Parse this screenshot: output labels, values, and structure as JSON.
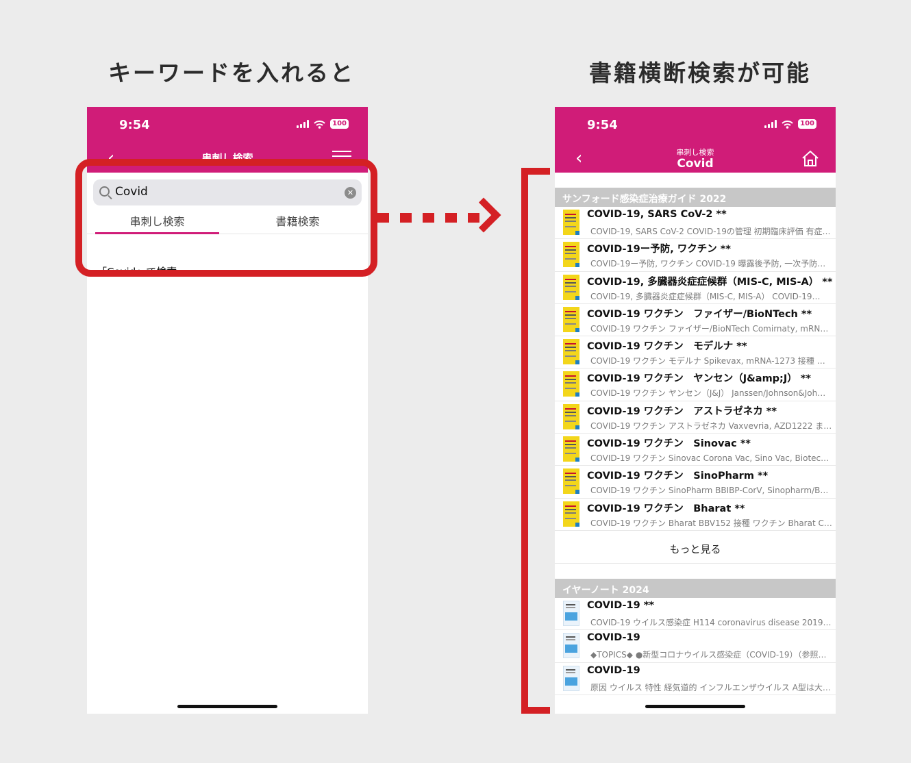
{
  "headings": {
    "left": "キーワードを入れると",
    "right": "書籍横断検索が可能"
  },
  "left_phone": {
    "time": "9:54",
    "battery": "100",
    "nav_title": "串刺し検索",
    "search_value": "Covid",
    "tabs": [
      "串刺し検索",
      "書籍検索"
    ],
    "suggestion": "「Covid」で検索"
  },
  "right_phone": {
    "time": "9:54",
    "battery": "100",
    "nav_sub": "串刺し検索",
    "nav_title": "Covid",
    "sections": [
      {
        "title": "サンフォード感染症治療ガイド 2022",
        "thumb": "yellow",
        "items": [
          {
            "title": "COVID-19, SARS CoV-2 **",
            "sub": "COVID-19, SARS CoV-2 COVID-19の管理 初期臨床評価 有症…"
          },
          {
            "title": "COVID-19ー予防, ワクチン **",
            "sub": "COVID-19ー予防, ワクチン COVID-19 曝露後予防, 一次予防…"
          },
          {
            "title": "COVID-19, 多臓器炎症症候群（MIS-C, MIS-A） **",
            "sub": "COVID-19, 多臓器炎症症候群（MIS-C, MIS-A） COVID-19…"
          },
          {
            "title": "COVID-19 ワクチン　ファイザー/BioNTech **",
            "sub": "COVID-19 ワクチン ファイザー/BioNTech Comirnaty, mRNA…"
          },
          {
            "title": "COVID-19 ワクチン　モデルナ **",
            "sub": "COVID-19 ワクチン モデルナ Spikevax, mRNA-1273 接種 ワ…"
          },
          {
            "title": "COVID-19 ワクチン　ヤンセン（J&amp;J） **",
            "sub": "COVID-19 ワクチン ヤンセン（J&J） Janssen/Johnson&Joh…"
          },
          {
            "title": "COVID-19 ワクチン　アストラゼネカ **",
            "sub": "COVID-19 ワクチン アストラゼネカ Vaxvevria, AZD1222 また…"
          },
          {
            "title": "COVID-19 ワクチン　Sinovac **",
            "sub": "COVID-19 ワクチン Sinovac Corona Vac, Sino Vac, Biotech…"
          },
          {
            "title": "COVID-19 ワクチン　SinoPharm **",
            "sub": "COVID-19 ワクチン SinoPharm BBIBP-CorV, Sinopharm/Beij…"
          },
          {
            "title": "COVID-19 ワクチン　Bharat **",
            "sub": "COVID-19 ワクチン Bharat BBV152 接種 ワクチン Bharat CO…"
          }
        ],
        "more": "もっと見る"
      },
      {
        "title": "イヤーノート 2024",
        "thumb": "blue",
        "items": [
          {
            "title": "COVID-19 **",
            "sub": "COVID-19 ウイルス感染症 H114 coronavirus disease 2019…"
          },
          {
            "title": "COVID-19",
            "sub": "◆TOPICS◆ ●新型コロナウイルス感染症（COVID-19）（参照…"
          },
          {
            "title": "COVID-19",
            "sub": "原因 ウイルス 特性 経気道的 インフルエンザウイルス A型は大…"
          }
        ]
      }
    ]
  },
  "colors": {
    "brand": "#d01c78",
    "annotation_red": "#d42024",
    "section_gray": "#c7c7c7"
  }
}
